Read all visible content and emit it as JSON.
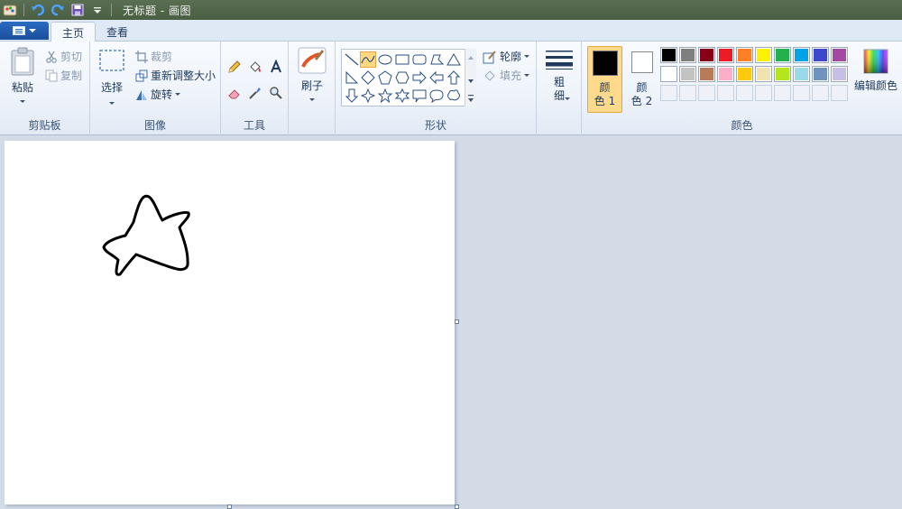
{
  "window": {
    "title": "无标题 - 画图"
  },
  "tabs": [
    {
      "label": "主页",
      "active": true
    },
    {
      "label": "查看",
      "active": false
    }
  ],
  "clipboard": {
    "group_label": "剪贴板",
    "paste": "粘贴",
    "cut": "剪切",
    "copy": "复制"
  },
  "image": {
    "group_label": "图像",
    "select": "选择",
    "crop": "裁剪",
    "resize": "重新调整大小",
    "rotate": "旋转"
  },
  "tools": {
    "group_label": "工具",
    "items": [
      "pencil-icon",
      "fill-bucket-icon",
      "text-icon",
      "eraser-icon",
      "color-picker-icon",
      "magnifier-icon"
    ]
  },
  "brushes": {
    "label": "刷子"
  },
  "shapes": {
    "group_label": "形状",
    "outline": "轮廓",
    "fill": "填充",
    "selected": "curve"
  },
  "size": {
    "label_line1": "粗",
    "label_line2": "细"
  },
  "colors": {
    "group_label": "颜色",
    "color1_line1": "颜",
    "color1_line2": "色 1",
    "color2_line1": "颜",
    "color2_line2": "色 2",
    "edit_colors": "编辑颜色",
    "color1_value": "#000000",
    "color2_value": "#ffffff",
    "palette_row1": [
      "#000000",
      "#7f7f7f",
      "#880015",
      "#ed1c24",
      "#ff7f27",
      "#fff200",
      "#22b14c",
      "#00a2e8",
      "#3f48cc",
      "#a349a4"
    ],
    "palette_row2": [
      "#ffffff",
      "#c3c3c3",
      "#b97a57",
      "#ffaec9",
      "#ffc90e",
      "#efe4b0",
      "#b5e61d",
      "#99d9ea",
      "#7092be",
      "#c8bfe7"
    ]
  }
}
